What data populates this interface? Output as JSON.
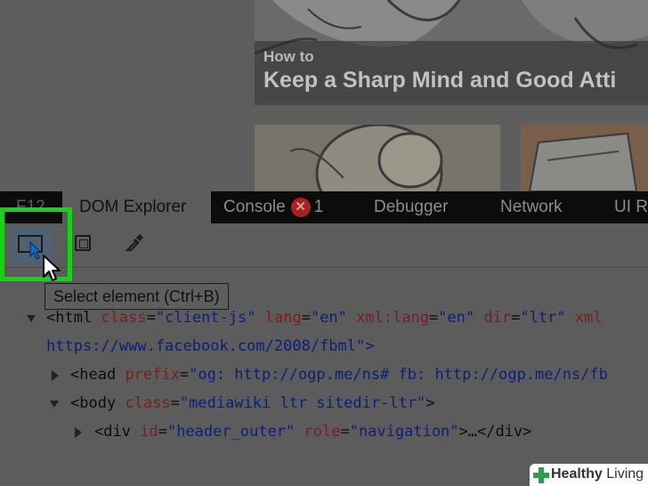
{
  "webpage": {
    "hero_kicker": "How to",
    "hero_title": "Keep a Sharp Mind and Good Atti"
  },
  "devtools": {
    "f12_label": "F12",
    "tabs": [
      {
        "label": "DOM Explorer",
        "active": true
      },
      {
        "label": "Console",
        "error_count": "1"
      },
      {
        "label": "Debugger"
      },
      {
        "label": "Network"
      },
      {
        "label": "UI R"
      }
    ],
    "toolbar": {
      "select_element_icon": "select-element-cursor-icon",
      "box_model_icon": "box-outline-icon",
      "color_picker_icon": "eyedropper-icon"
    },
    "tooltip": "Select element (Ctrl+B)",
    "dom": {
      "html": {
        "tag": "html",
        "a1": "class",
        "v1": "\"client-js\"",
        "a2": "lang",
        "v2": "\"en\"",
        "a3": "xml:lang",
        "v3": "\"en\"",
        "a4": "dir",
        "v4": "\"ltr\"",
        "a5": "xml"
      },
      "html_cont": {
        "url": "https://www.facebook.com/2008/fbml",
        "close": "\">"
      },
      "head": {
        "tag": "head",
        "a1": "prefix",
        "v1": "\"og: http://ogp.me/ns# fb: http://ogp.me/ns/fb"
      },
      "body": {
        "tag": "body",
        "a1": "class",
        "v1": "\"mediawiki ltr sitedir-ltr\""
      },
      "div": {
        "tag": "div",
        "a1": "id",
        "v1": "\"header_outer\"",
        "a2": "role",
        "v2": "\"navigation\"",
        "end": ">…</div>"
      }
    }
  },
  "watermark": {
    "brand_bold": "Healthy",
    "brand_light": "Living"
  },
  "colors": {
    "highlight": "#16d316",
    "tabbar_bg": "#0c0c0c",
    "panel_bg": "#5c5c5c",
    "error_red": "#a62222"
  }
}
